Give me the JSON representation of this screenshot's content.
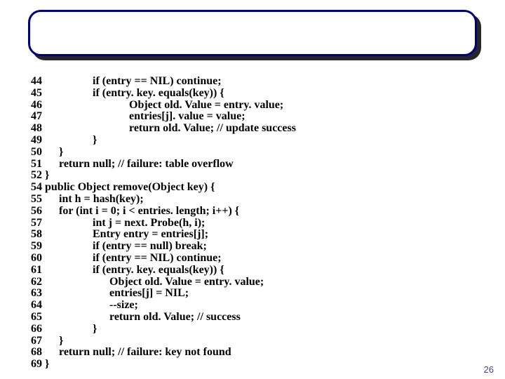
{
  "page_number": "26",
  "code": {
    "lines": [
      {
        "num": "44",
        "text": "                  if (entry == NIL) continue;"
      },
      {
        "num": "45",
        "text": "                  if (entry. key. equals(key)) {"
      },
      {
        "num": "46",
        "text": "                               Object old. Value = entry. value;"
      },
      {
        "num": "47",
        "text": "                               entries[j]. value = value;"
      },
      {
        "num": "48",
        "text": "                               return old. Value; // update success"
      },
      {
        "num": "49",
        "text": "                  }"
      },
      {
        "num": "50",
        "text": "      }"
      },
      {
        "num": "51",
        "text": "      return null; // failure: table overflow"
      },
      {
        "num": "52",
        "text": " }"
      },
      {
        "num": "54",
        "text": " public Object remove(Object key) {"
      },
      {
        "num": "55",
        "text": "      int h = hash(key);"
      },
      {
        "num": "56",
        "text": "      for (int i = 0; i < entries. length; i++) {"
      },
      {
        "num": "57",
        "text": "                  int j = next. Probe(h, i);"
      },
      {
        "num": "58",
        "text": "                  Entry entry = entries[j];"
      },
      {
        "num": "59",
        "text": "                  if (entry == null) break;"
      },
      {
        "num": "60",
        "text": "                  if (entry == NIL) continue;"
      },
      {
        "num": "61",
        "text": "                  if (entry. key. equals(key)) {"
      },
      {
        "num": "62",
        "text": "                        Object old. Value = entry. value;"
      },
      {
        "num": "63",
        "text": "                        entries[j] = NIL;"
      },
      {
        "num": "64",
        "text": "                        --size;"
      },
      {
        "num": "65",
        "text": "                        return old. Value; // success"
      },
      {
        "num": "66",
        "text": "                  }"
      },
      {
        "num": "67",
        "text": "      }"
      },
      {
        "num": "68",
        "text": "      return null; // failure: key not found"
      },
      {
        "num": "69",
        "text": " }"
      }
    ]
  }
}
